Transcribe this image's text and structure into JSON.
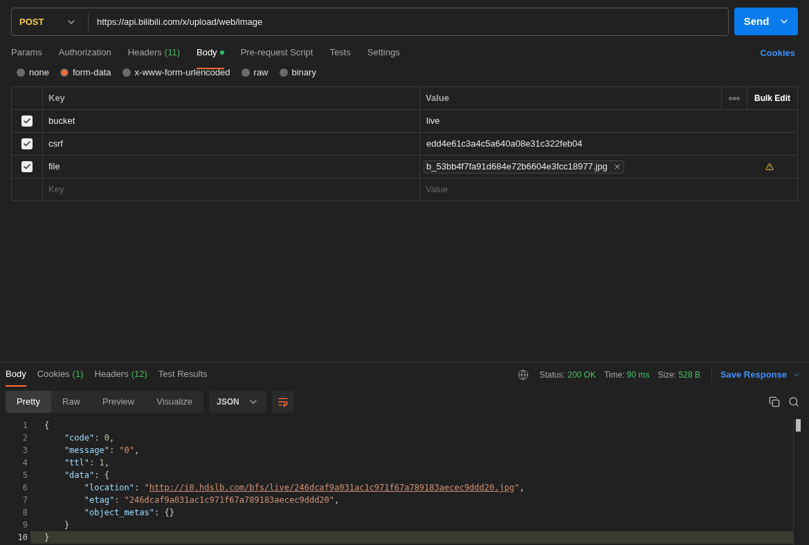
{
  "request": {
    "method": "POST",
    "url": "https://api.bilibili.com/x/upload/web/image",
    "send": "Send"
  },
  "tabs": [
    {
      "label": "Params",
      "selected": false
    },
    {
      "label": "Authorization",
      "selected": false
    },
    {
      "label": "Headers",
      "count": "(11)",
      "selected": false
    },
    {
      "label": "Body",
      "dot": true,
      "selected": true
    },
    {
      "label": "Pre-request Script",
      "selected": false
    },
    {
      "label": "Tests",
      "selected": false
    },
    {
      "label": "Settings",
      "selected": false
    }
  ],
  "cookies_link": "Cookies",
  "body_types": [
    {
      "label": "none",
      "selected": false
    },
    {
      "label": "form-data",
      "selected": true
    },
    {
      "label": "x-www-form-urlencoded",
      "selected": false
    },
    {
      "label": "raw",
      "selected": false
    },
    {
      "label": "binary",
      "selected": false
    }
  ],
  "table": {
    "columns": [
      "Key",
      "Value"
    ],
    "bulk_edit": "Bulk Edit",
    "rows": [
      {
        "checked": true,
        "key": "bucket",
        "value": "live",
        "kind": "text",
        "warning": false
      },
      {
        "checked": true,
        "key": "csrf",
        "value": "edd4e61c3a4c5a640a08e31c322feb04",
        "kind": "text",
        "warning": false
      },
      {
        "checked": true,
        "key": "file",
        "value": "b_53bb4f7fa91d684e72b6604e3fcc18977.jpg",
        "kind": "file",
        "warning": true
      }
    ],
    "new_row": {
      "key_placeholder": "Key",
      "value_placeholder": "Value"
    }
  },
  "response": {
    "tabs": [
      {
        "label": "Body",
        "selected": true
      },
      {
        "label": "Cookies",
        "count": "(1)",
        "selected": false
      },
      {
        "label": "Headers",
        "count": "(12)",
        "selected": false
      },
      {
        "label": "Test Results",
        "selected": false
      }
    ],
    "status": [
      {
        "label": "Status:",
        "value": "200 OK"
      },
      {
        "label": "Time:",
        "value": "90 ms"
      },
      {
        "label": "Size:",
        "value": "528 B"
      }
    ],
    "save": "Save Response",
    "views": [
      {
        "label": "Pretty",
        "selected": true
      },
      {
        "label": "Raw",
        "selected": false
      },
      {
        "label": "Preview",
        "selected": false
      },
      {
        "label": "Visualize",
        "selected": false
      }
    ],
    "format": "JSON",
    "lines": [
      {
        "number": "1",
        "current": false,
        "tokens": [
          {
            "kind": "punct",
            "text": "{"
          }
        ]
      },
      {
        "number": "2",
        "current": false,
        "tokens": [
          {
            "kind": "key",
            "text": "    \"code\""
          },
          {
            "kind": "punct",
            "text": ": "
          },
          {
            "kind": "number",
            "text": "0"
          },
          {
            "kind": "punct",
            "text": ","
          }
        ]
      },
      {
        "number": "3",
        "current": false,
        "tokens": [
          {
            "kind": "key",
            "text": "    \"message\""
          },
          {
            "kind": "punct",
            "text": ": "
          },
          {
            "kind": "string",
            "text": "\"0\""
          },
          {
            "kind": "punct",
            "text": ","
          }
        ]
      },
      {
        "number": "4",
        "current": false,
        "tokens": [
          {
            "kind": "key",
            "text": "    \"ttl\""
          },
          {
            "kind": "punct",
            "text": ": "
          },
          {
            "kind": "number",
            "text": "1"
          },
          {
            "kind": "punct",
            "text": ","
          }
        ]
      },
      {
        "number": "5",
        "current": false,
        "tokens": [
          {
            "kind": "key",
            "text": "    \"data\""
          },
          {
            "kind": "punct",
            "text": ": {"
          }
        ]
      },
      {
        "number": "6",
        "current": false,
        "tokens": [
          {
            "kind": "key",
            "text": "        \"location\""
          },
          {
            "kind": "punct",
            "text": ": "
          },
          {
            "kind": "string",
            "text": "\""
          },
          {
            "kind": "link",
            "text": "http://i0.hdslb.com/bfs/live/246dcaf9a031ac1c971f67a789183aecec9ddd20.jpg"
          },
          {
            "kind": "string",
            "text": "\""
          },
          {
            "kind": "punct",
            "text": ","
          }
        ]
      },
      {
        "number": "7",
        "current": false,
        "tokens": [
          {
            "kind": "key",
            "text": "        \"etag\""
          },
          {
            "kind": "punct",
            "text": ": "
          },
          {
            "kind": "string",
            "text": "\"246dcaf9a031ac1c971f67a789183aecec9ddd20\""
          },
          {
            "kind": "punct",
            "text": ","
          }
        ]
      },
      {
        "number": "8",
        "current": false,
        "tokens": [
          {
            "kind": "key",
            "text": "        \"object_metas\""
          },
          {
            "kind": "punct",
            "text": ": {}"
          }
        ]
      },
      {
        "number": "9",
        "current": false,
        "tokens": [
          {
            "kind": "punct",
            "text": "    }"
          }
        ]
      },
      {
        "number": "10",
        "current": true,
        "tokens": [
          {
            "kind": "punct",
            "text": "}"
          }
        ]
      }
    ]
  }
}
